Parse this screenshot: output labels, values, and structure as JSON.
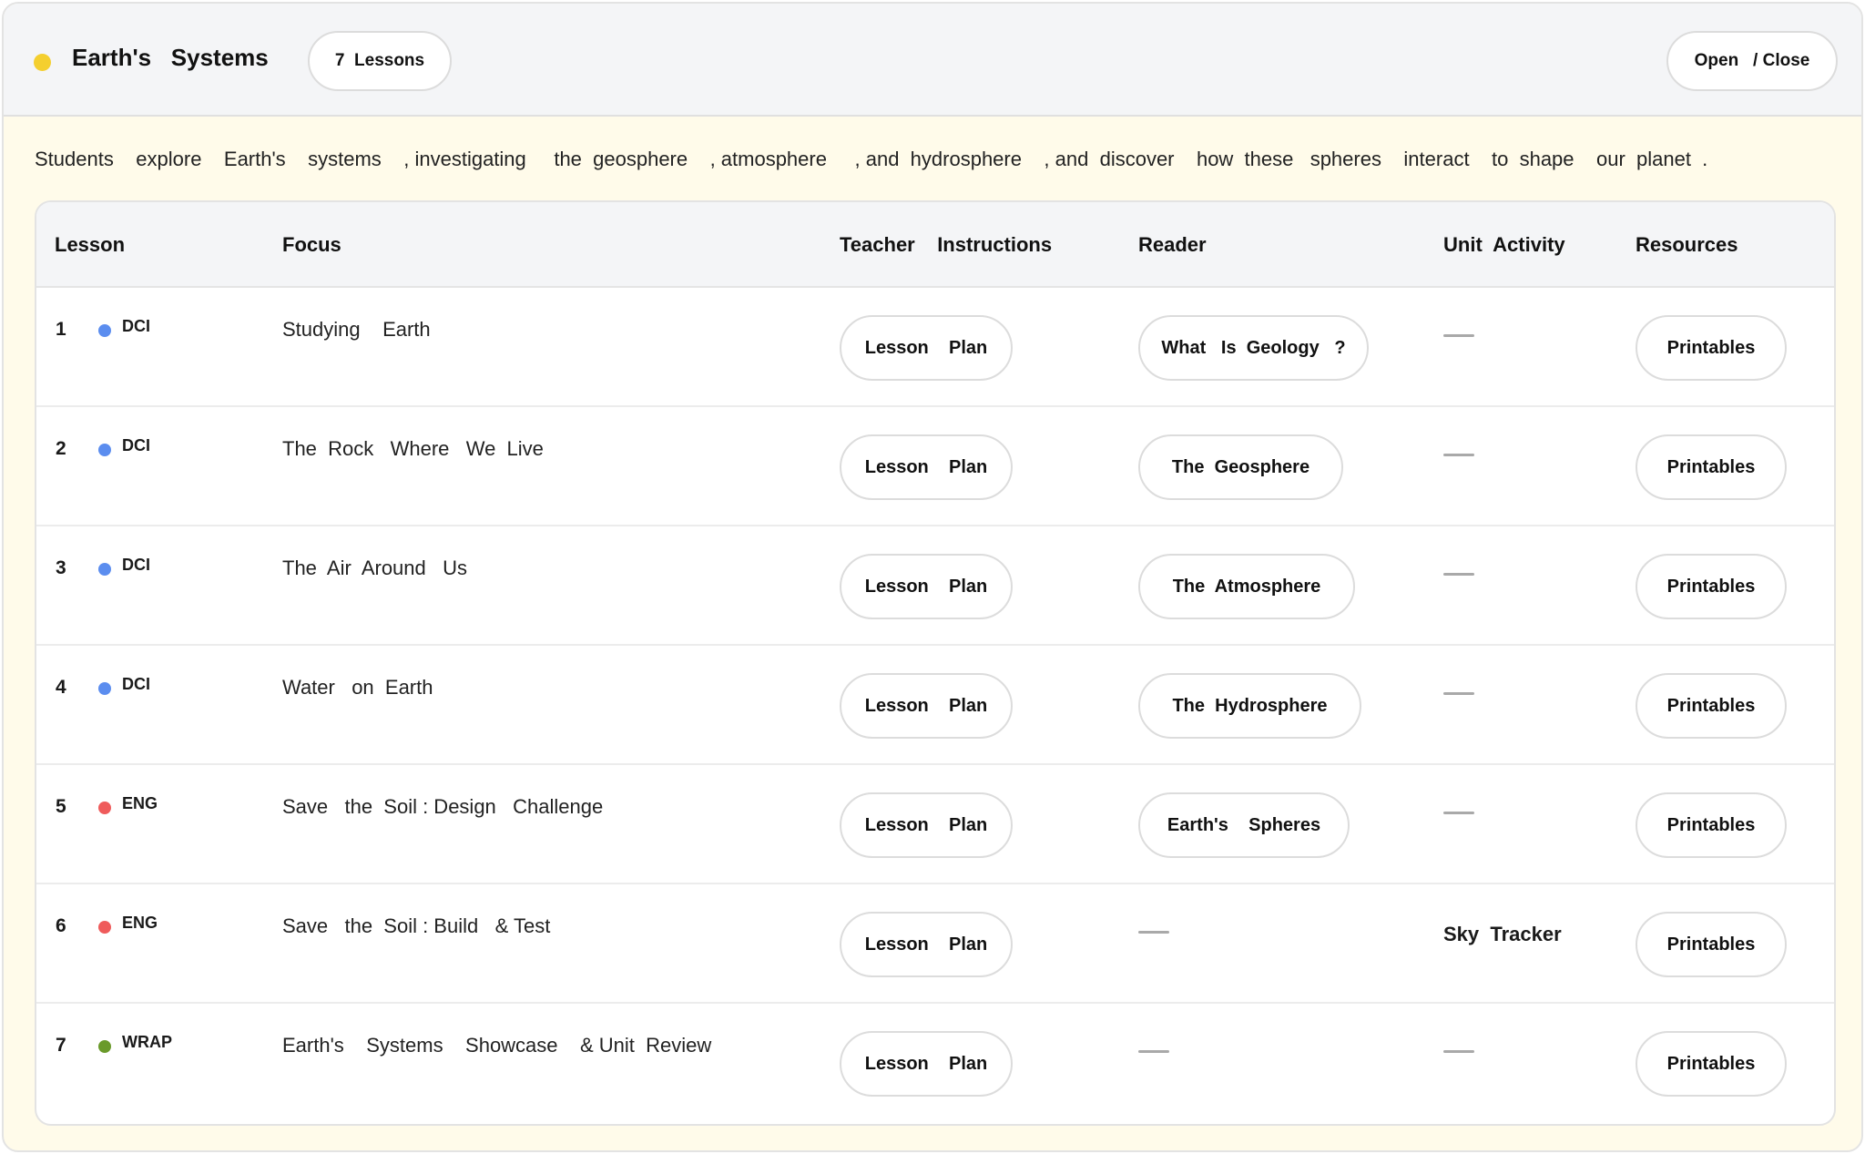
{
  "header": {
    "title": "Earth's   Systems",
    "lessons_label": "7  Lessons",
    "open_close_label": "Open   / Close",
    "dot_color": "#f4cf2f"
  },
  "description": "Students    explore    Earth's    systems    , investigating     the  geosphere    , atmosphere     , and  hydrosphere    , and  discover    how  these   spheres    interact    to  shape    our  planet  .",
  "table": {
    "columns": [
      "Lesson",
      "Focus",
      "Teacher    Instructions",
      "Reader",
      "Unit  Activity",
      "Resources"
    ],
    "rows": [
      {
        "number": "1",
        "tag": "DCI",
        "tag_color": "#5b8def",
        "focus": "Studying    Earth",
        "teacher": "Lesson    Plan",
        "reader": "What   Is  Geology   ?",
        "unit_activity": null,
        "resources": "Printables"
      },
      {
        "number": "2",
        "tag": "DCI",
        "tag_color": "#5b8def",
        "focus": "The  Rock   Where   We  Live",
        "teacher": "Lesson    Plan",
        "reader": "The  Geosphere",
        "unit_activity": null,
        "resources": "Printables"
      },
      {
        "number": "3",
        "tag": "DCI",
        "tag_color": "#5b8def",
        "focus": "The  Air  Around   Us",
        "teacher": "Lesson    Plan",
        "reader": "The  Atmosphere",
        "unit_activity": null,
        "resources": "Printables"
      },
      {
        "number": "4",
        "tag": "DCI",
        "tag_color": "#5b8def",
        "focus": "Water   on  Earth",
        "teacher": "Lesson    Plan",
        "reader": "The  Hydrosphere",
        "unit_activity": null,
        "resources": "Printables"
      },
      {
        "number": "5",
        "tag": "ENG",
        "tag_color": "#ef5b5b",
        "focus": "Save   the  Soil : Design   Challenge",
        "teacher": "Lesson    Plan",
        "reader": "Earth's    Spheres",
        "unit_activity": null,
        "resources": "Printables"
      },
      {
        "number": "6",
        "tag": "ENG",
        "tag_color": "#ef5b5b",
        "focus": "Save   the  Soil : Build   & Test",
        "teacher": "Lesson    Plan",
        "reader": null,
        "unit_activity": "Sky  Tracker",
        "resources": "Printables"
      },
      {
        "number": "7",
        "tag": "WRAP",
        "tag_color": "#6a9a2a",
        "focus": "Earth's    Systems    Showcase    & Unit  Review",
        "teacher": "Lesson    Plan",
        "reader": null,
        "unit_activity": null,
        "resources": "Printables"
      }
    ]
  }
}
